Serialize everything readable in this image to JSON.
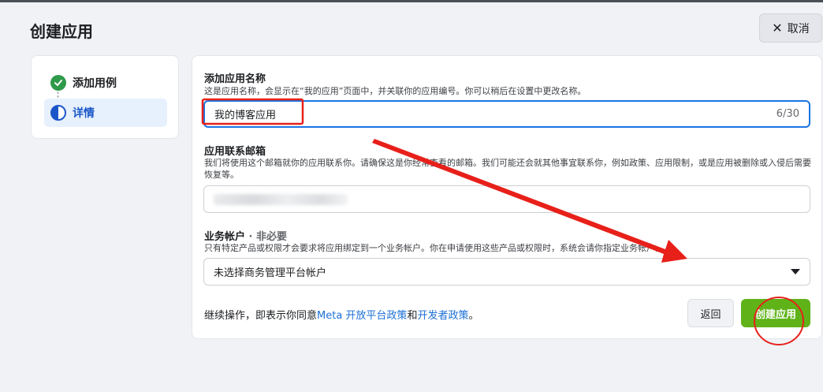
{
  "header": {
    "title": "创建应用",
    "cancel_label": "取消"
  },
  "steps": [
    {
      "label": "添加用例",
      "state": "complete"
    },
    {
      "label": "详情",
      "state": "current"
    }
  ],
  "form": {
    "app_name": {
      "label": "添加应用名称",
      "description": "这是应用名称，会显示在“我的应用”页面中，并关联你的应用编号。你可以稍后在设置中更改名称。",
      "value": "我的博客应用",
      "counter": "6/30"
    },
    "contact_email": {
      "label": "应用联系邮箱",
      "description": "我们将使用这个邮箱就你的应用联系你。请确保这是你经常查看的邮箱。我们可能还会就其他事宜联系你，例如政策、应用限制，或是应用被删除或入侵后需要恢复等。"
    },
    "business_account": {
      "label": "业务帐户",
      "optional": " · 非必要",
      "description": "只有特定产品或权限才会要求将应用绑定到一个业务帐户。你在申请使用这些产品或权限时，系统会请你指定业务帐户。",
      "selected": "未选择商务管理平台帐户"
    },
    "footer": {
      "prefix": "继续操作，即表示你同意",
      "link1": "Meta 开放平台政策",
      "and": "和",
      "link2": "开发者政策",
      "suffix": "。"
    },
    "back_label": "返回",
    "create_label": "创建应用"
  },
  "colors": {
    "accent": "#1b74e4",
    "create_button": "#5fb319",
    "annotation": "#e8201a"
  }
}
